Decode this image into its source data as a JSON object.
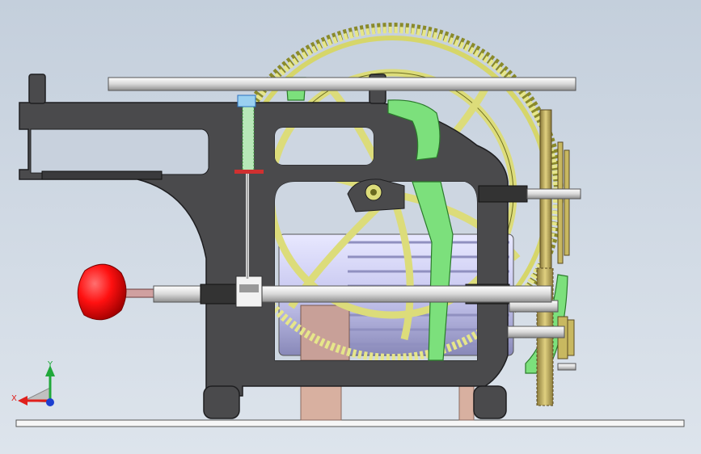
{
  "view": {
    "background_top": "#c4cfdc",
    "background_bottom": "#dde4ec"
  },
  "triad": {
    "x_label": "X",
    "y_label": "Y",
    "x_color": "#e0201c",
    "y_color": "#20a83a",
    "z_color": "#1c3fd0"
  },
  "parts": {
    "frame": {
      "color": "#4a4a4c"
    },
    "large_gear": {
      "color": "#dcdc7a",
      "spokes": 6
    },
    "green_lever": {
      "color": "#7ce07c"
    },
    "motor": {
      "color": "#c8c8f0"
    },
    "handle_knob": {
      "color": "#ff1010"
    },
    "base_plate": {
      "color": "#f4f4f4"
    },
    "bronze_gear": {
      "color": "#c8b860"
    },
    "pinkish_columns": {
      "color": "#d8b0a0"
    }
  }
}
